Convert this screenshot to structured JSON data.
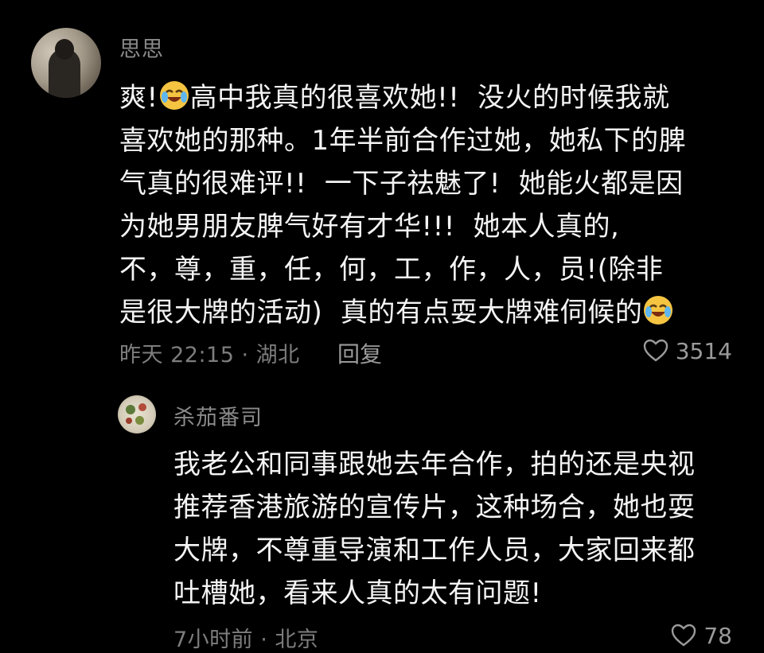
{
  "comment": {
    "username": "思思",
    "lines": [
      "爽!",
      "高中我真的很喜欢她!!  没火的时候我就",
      "喜欢她的那种。1年半前合作过她，她私下的脾",
      "气真的很难评!!  一下子祛魅了!  她能火都是因",
      "为她男朋友脾气好有才华!!!  她本人真的,",
      "不，尊，重，任，何，工，作，人，员!(除非",
      "是很大牌的活动)  真的有点耍大牌难伺候的"
    ],
    "meta": "昨天 22:15 · 湖北",
    "reply_label": "回复",
    "likes": "3514",
    "emoji_icon": "crying-laughing-emoji-icon"
  },
  "reply": {
    "username": "杀茄番司",
    "lines": [
      "我老公和同事跟她去年合作，拍的还是央视",
      "推荐香港旅游的宣传片，这种场合，她也耍",
      "大牌，不尊重导演和工作人员，大家回来都",
      "吐槽她，看来人真的太有问题!"
    ],
    "meta": "7小时前 · 北京",
    "likes": "78"
  },
  "colors": {
    "background": "#000000",
    "text": "#f4f4f4",
    "muted": "#7d7d7d"
  }
}
